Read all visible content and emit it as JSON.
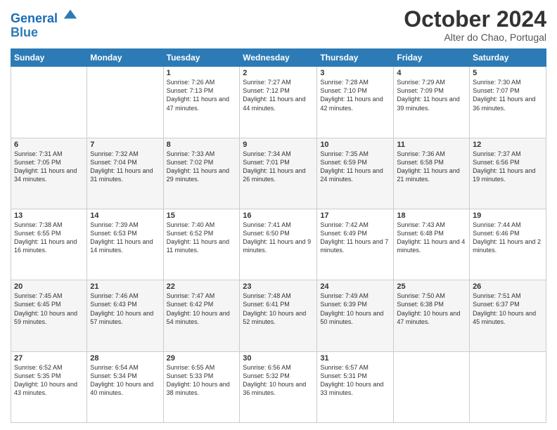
{
  "logo": {
    "line1": "General",
    "line2": "Blue"
  },
  "header": {
    "title": "October 2024",
    "subtitle": "Alter do Chao, Portugal"
  },
  "weekdays": [
    "Sunday",
    "Monday",
    "Tuesday",
    "Wednesday",
    "Thursday",
    "Friday",
    "Saturday"
  ],
  "weeks": [
    [
      {
        "day": "",
        "sunrise": "",
        "sunset": "",
        "daylight": ""
      },
      {
        "day": "",
        "sunrise": "",
        "sunset": "",
        "daylight": ""
      },
      {
        "day": "1",
        "sunrise": "Sunrise: 7:26 AM",
        "sunset": "Sunset: 7:13 PM",
        "daylight": "Daylight: 11 hours and 47 minutes."
      },
      {
        "day": "2",
        "sunrise": "Sunrise: 7:27 AM",
        "sunset": "Sunset: 7:12 PM",
        "daylight": "Daylight: 11 hours and 44 minutes."
      },
      {
        "day": "3",
        "sunrise": "Sunrise: 7:28 AM",
        "sunset": "Sunset: 7:10 PM",
        "daylight": "Daylight: 11 hours and 42 minutes."
      },
      {
        "day": "4",
        "sunrise": "Sunrise: 7:29 AM",
        "sunset": "Sunset: 7:09 PM",
        "daylight": "Daylight: 11 hours and 39 minutes."
      },
      {
        "day": "5",
        "sunrise": "Sunrise: 7:30 AM",
        "sunset": "Sunset: 7:07 PM",
        "daylight": "Daylight: 11 hours and 36 minutes."
      }
    ],
    [
      {
        "day": "6",
        "sunrise": "Sunrise: 7:31 AM",
        "sunset": "Sunset: 7:05 PM",
        "daylight": "Daylight: 11 hours and 34 minutes."
      },
      {
        "day": "7",
        "sunrise": "Sunrise: 7:32 AM",
        "sunset": "Sunset: 7:04 PM",
        "daylight": "Daylight: 11 hours and 31 minutes."
      },
      {
        "day": "8",
        "sunrise": "Sunrise: 7:33 AM",
        "sunset": "Sunset: 7:02 PM",
        "daylight": "Daylight: 11 hours and 29 minutes."
      },
      {
        "day": "9",
        "sunrise": "Sunrise: 7:34 AM",
        "sunset": "Sunset: 7:01 PM",
        "daylight": "Daylight: 11 hours and 26 minutes."
      },
      {
        "day": "10",
        "sunrise": "Sunrise: 7:35 AM",
        "sunset": "Sunset: 6:59 PM",
        "daylight": "Daylight: 11 hours and 24 minutes."
      },
      {
        "day": "11",
        "sunrise": "Sunrise: 7:36 AM",
        "sunset": "Sunset: 6:58 PM",
        "daylight": "Daylight: 11 hours and 21 minutes."
      },
      {
        "day": "12",
        "sunrise": "Sunrise: 7:37 AM",
        "sunset": "Sunset: 6:56 PM",
        "daylight": "Daylight: 11 hours and 19 minutes."
      }
    ],
    [
      {
        "day": "13",
        "sunrise": "Sunrise: 7:38 AM",
        "sunset": "Sunset: 6:55 PM",
        "daylight": "Daylight: 11 hours and 16 minutes."
      },
      {
        "day": "14",
        "sunrise": "Sunrise: 7:39 AM",
        "sunset": "Sunset: 6:53 PM",
        "daylight": "Daylight: 11 hours and 14 minutes."
      },
      {
        "day": "15",
        "sunrise": "Sunrise: 7:40 AM",
        "sunset": "Sunset: 6:52 PM",
        "daylight": "Daylight: 11 hours and 11 minutes."
      },
      {
        "day": "16",
        "sunrise": "Sunrise: 7:41 AM",
        "sunset": "Sunset: 6:50 PM",
        "daylight": "Daylight: 11 hours and 9 minutes."
      },
      {
        "day": "17",
        "sunrise": "Sunrise: 7:42 AM",
        "sunset": "Sunset: 6:49 PM",
        "daylight": "Daylight: 11 hours and 7 minutes."
      },
      {
        "day": "18",
        "sunrise": "Sunrise: 7:43 AM",
        "sunset": "Sunset: 6:48 PM",
        "daylight": "Daylight: 11 hours and 4 minutes."
      },
      {
        "day": "19",
        "sunrise": "Sunrise: 7:44 AM",
        "sunset": "Sunset: 6:46 PM",
        "daylight": "Daylight: 11 hours and 2 minutes."
      }
    ],
    [
      {
        "day": "20",
        "sunrise": "Sunrise: 7:45 AM",
        "sunset": "Sunset: 6:45 PM",
        "daylight": "Daylight: 10 hours and 59 minutes."
      },
      {
        "day": "21",
        "sunrise": "Sunrise: 7:46 AM",
        "sunset": "Sunset: 6:43 PM",
        "daylight": "Daylight: 10 hours and 57 minutes."
      },
      {
        "day": "22",
        "sunrise": "Sunrise: 7:47 AM",
        "sunset": "Sunset: 6:42 PM",
        "daylight": "Daylight: 10 hours and 54 minutes."
      },
      {
        "day": "23",
        "sunrise": "Sunrise: 7:48 AM",
        "sunset": "Sunset: 6:41 PM",
        "daylight": "Daylight: 10 hours and 52 minutes."
      },
      {
        "day": "24",
        "sunrise": "Sunrise: 7:49 AM",
        "sunset": "Sunset: 6:39 PM",
        "daylight": "Daylight: 10 hours and 50 minutes."
      },
      {
        "day": "25",
        "sunrise": "Sunrise: 7:50 AM",
        "sunset": "Sunset: 6:38 PM",
        "daylight": "Daylight: 10 hours and 47 minutes."
      },
      {
        "day": "26",
        "sunrise": "Sunrise: 7:51 AM",
        "sunset": "Sunset: 6:37 PM",
        "daylight": "Daylight: 10 hours and 45 minutes."
      }
    ],
    [
      {
        "day": "27",
        "sunrise": "Sunrise: 6:52 AM",
        "sunset": "Sunset: 5:35 PM",
        "daylight": "Daylight: 10 hours and 43 minutes."
      },
      {
        "day": "28",
        "sunrise": "Sunrise: 6:54 AM",
        "sunset": "Sunset: 5:34 PM",
        "daylight": "Daylight: 10 hours and 40 minutes."
      },
      {
        "day": "29",
        "sunrise": "Sunrise: 6:55 AM",
        "sunset": "Sunset: 5:33 PM",
        "daylight": "Daylight: 10 hours and 38 minutes."
      },
      {
        "day": "30",
        "sunrise": "Sunrise: 6:56 AM",
        "sunset": "Sunset: 5:32 PM",
        "daylight": "Daylight: 10 hours and 36 minutes."
      },
      {
        "day": "31",
        "sunrise": "Sunrise: 6:57 AM",
        "sunset": "Sunset: 5:31 PM",
        "daylight": "Daylight: 10 hours and 33 minutes."
      },
      {
        "day": "",
        "sunrise": "",
        "sunset": "",
        "daylight": ""
      },
      {
        "day": "",
        "sunrise": "",
        "sunset": "",
        "daylight": ""
      }
    ]
  ]
}
